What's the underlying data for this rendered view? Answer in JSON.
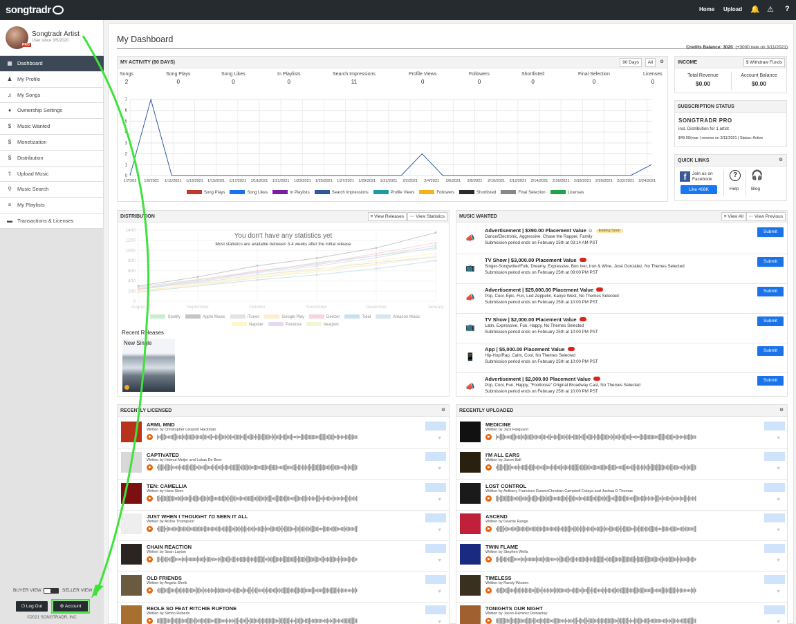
{
  "brand": {
    "logo": "songtradr"
  },
  "topnav": {
    "home": "Home",
    "upload": "Upload",
    "bell_icon": "bell-icon",
    "alert_icon": "warning-icon",
    "help": "?"
  },
  "profile": {
    "name": "Songtradr Artist",
    "since": "User since 3/5/2020",
    "badge": "PRO"
  },
  "sidebar": {
    "items": [
      {
        "label": "Dashboard",
        "icon": "dashboard-icon"
      },
      {
        "label": "My Profile",
        "icon": "user-icon"
      },
      {
        "label": "My Songs",
        "icon": "music-note-icon"
      },
      {
        "label": "Ownership Settings",
        "icon": "shield-icon"
      },
      {
        "label": "Music Wanted",
        "icon": "dollar-icon"
      },
      {
        "label": "Monetization",
        "icon": "dollar-icon"
      },
      {
        "label": "Distribution",
        "icon": "dollar-icon"
      },
      {
        "label": "Upload Music",
        "icon": "upload-icon"
      },
      {
        "label": "Music Search",
        "icon": "search-icon"
      },
      {
        "label": "My Playlists",
        "icon": "playlist-icon"
      },
      {
        "label": "Transactions & Licenses",
        "icon": "card-icon"
      }
    ],
    "buyer_view": "BUYER VIEW",
    "seller_view": "SELLER VIEW",
    "logout": "Log Out",
    "account": "Account",
    "copyright": "©2021 SONGTRADR, INC"
  },
  "page": {
    "title": "My Dashboard",
    "credits_label": "Credits Balance:",
    "credits_value": "3020",
    "credits_note": "(+3000 new on 3/11/2021)"
  },
  "activity": {
    "title": "MY ACTIVITY (90 DAYS)",
    "range_90": "90 Days",
    "range_all": "All",
    "stats": [
      {
        "label": "Songs",
        "value": "2"
      },
      {
        "label": "Song Plays",
        "value": "0"
      },
      {
        "label": "Song Likes",
        "value": "0"
      },
      {
        "label": "In Playlists",
        "value": "0"
      },
      {
        "label": "Search Impressions",
        "value": "11"
      },
      {
        "label": "Profile Views",
        "value": "0"
      },
      {
        "label": "Followers",
        "value": "0"
      },
      {
        "label": "Shortlisted",
        "value": "0"
      },
      {
        "label": "Final Selection",
        "value": "0"
      },
      {
        "label": "Licenses",
        "value": "0"
      }
    ]
  },
  "chart_data": [
    {
      "type": "line",
      "x": [
        "1/7/2021",
        "1/9/2021",
        "1/11/2021",
        "1/13/2021",
        "1/15/2021",
        "1/17/2021",
        "1/19/2021",
        "1/21/2021",
        "1/23/2021",
        "1/25/2021",
        "1/27/2021",
        "1/29/2021",
        "1/31/2021",
        "2/2/2021",
        "2/4/2021",
        "2/6/2021",
        "2/8/2021",
        "2/10/2021",
        "2/12/2021",
        "2/14/2021",
        "2/16/2021",
        "2/18/2021",
        "2/20/2021",
        "2/22/2021",
        "2/24/2021"
      ],
      "x_tick_labels": [
        "1/7/202",
        "1/9/2021",
        "1/11/2021",
        "1/13/2021",
        "1/15/2021",
        "1/17/2021",
        "1/19/2021",
        "1/21/2021",
        "1/23/2021",
        "1/25/2021",
        "1/27/2021",
        "1/29/2021",
        "1/31/2021",
        "2/2/2021",
        "2/4/2021",
        "2/6/2021",
        "2/8/2021",
        "2/10/2021",
        "2/12/2021",
        "2/14/2021",
        "2/16/2021",
        "2/18/2021",
        "2/20/2021",
        "2/22/2021",
        "2/24/2021"
      ],
      "y_ticks": [
        "0",
        "1",
        "2",
        "3",
        "4",
        "5",
        "6",
        "7"
      ],
      "ylim": [
        0,
        7
      ],
      "series": [
        {
          "name": "Song Plays",
          "color": "#c0392b",
          "values": []
        },
        {
          "name": "Song Likes",
          "color": "#1a73e8",
          "values": []
        },
        {
          "name": "In Playlists",
          "color": "#7b1fa2",
          "values": []
        },
        {
          "name": "Search Impressions",
          "color": "#2c5aa0",
          "values": [
            0,
            7,
            0,
            0,
            0,
            0,
            0,
            0,
            0,
            0,
            0,
            0,
            0,
            0,
            2,
            0,
            0,
            0,
            0,
            0,
            0,
            0,
            0,
            0,
            0,
            1
          ]
        },
        {
          "name": "Profile Views",
          "color": "#1e9aa8",
          "values": []
        },
        {
          "name": "Followers",
          "color": "#f5b21b",
          "values": []
        },
        {
          "name": "Shortlisted",
          "color": "#2b2b2b",
          "values": []
        },
        {
          "name": "Final Selection",
          "color": "#888888",
          "values": []
        },
        {
          "name": "Licenses",
          "color": "#22a34a",
          "values": []
        }
      ],
      "grid": true,
      "legend": "bottom"
    },
    {
      "type": "line",
      "categories": [
        "August",
        "September",
        "October",
        "November",
        "December",
        "January"
      ],
      "y_ticks": [
        "0",
        "200",
        "400",
        "600",
        "800",
        "1000",
        "1200",
        "1400"
      ],
      "ylim": [
        0,
        1400
      ],
      "series": [
        {
          "name": "Spotify",
          "color": "#a8e0b0",
          "values": [
            280,
            430,
            580,
            760,
            900,
            1040
          ]
        },
        {
          "name": "Apple Music",
          "color": "#a0a0a0",
          "values": [
            300,
            480,
            700,
            850,
            1050,
            1350
          ]
        },
        {
          "name": "iTunes",
          "color": "#d0d0d0",
          "values": [
            260,
            360,
            520,
            640,
            760,
            880
          ]
        },
        {
          "name": "Google Play",
          "color": "#fde3b0",
          "values": [
            200,
            330,
            470,
            610,
            730,
            870
          ]
        },
        {
          "name": "Deezer",
          "color": "#f5b9c8",
          "values": [
            250,
            420,
            600,
            740,
            940,
            1150
          ]
        },
        {
          "name": "Tidal",
          "color": "#a8cde8",
          "values": [
            180,
            300,
            420,
            520,
            640,
            800
          ]
        },
        {
          "name": "Amazon Music",
          "color": "#c0d4e8",
          "values": [
            230,
            380,
            560,
            690,
            860,
            1060
          ]
        },
        {
          "name": "Napster",
          "color": "#fff3a8",
          "values": [
            210,
            340,
            500,
            630,
            800,
            940
          ]
        },
        {
          "name": "Pandora",
          "color": "#d8c0e8",
          "values": [
            240,
            400,
            580,
            720,
            900,
            1100
          ]
        },
        {
          "name": "beatport",
          "color": "#e8f0b8",
          "values": [
            190,
            310,
            460,
            580,
            720,
            880
          ]
        }
      ],
      "legend": "bottom"
    }
  ],
  "income": {
    "title": "INCOME",
    "withdraw": "Withdraw Funds",
    "total_label": "Total Revenue",
    "total_value": "$0.00",
    "balance_label": "Account Balance",
    "balance_value": "$0.00"
  },
  "subscription": {
    "title": "SUBSCRIPTION STATUS",
    "plan": "SONGTRADR PRO",
    "desc": "incl. Distribution for 1 artist",
    "detail": "$49.00/year | renews on 3/11/2021 | Status: Active"
  },
  "quicklinks": {
    "title": "QUICK LINKS",
    "facebook1": "Join us on",
    "facebook2": "Facebook",
    "like": "Like 408K",
    "help": "Help",
    "blog": "Blog"
  },
  "distribution": {
    "title": "DISTRIBUTION",
    "view_releases": "View Releases",
    "view_statistics": "View Statistics",
    "empty_title": "You don't have any statistics yet",
    "empty_sub": "Most statistics are available between 3-4 weeks after the initial release",
    "recent_releases": "Recent Releases",
    "release_title": "New Single"
  },
  "music_wanted": {
    "title": "MUSIC WANTED",
    "view_all": "View All",
    "view_previous": "View Previous",
    "items": [
      {
        "title": "Advertisement | $390.00 Placement Value",
        "badge": "Ending Soon",
        "desc": "Dance/Electronic, Aggressive, Chase the Rapper, Family",
        "period": "Submission period ends on February 25th at 03:14 AM PST",
        "icon": "megaphone-icon",
        "submit": "Submit"
      },
      {
        "title": "TV Show | $3,000.00 Placement Value",
        "badge": "",
        "desc": "Singer-Songwriter/Folk, Dreamy, Expressive, Bon Iver, Iron & Wine, José González, No Themes Selected",
        "period": "Submission period ends on February 25th at 09:00 PM PST",
        "icon": "tv-icon",
        "submit": "Submit"
      },
      {
        "title": "Advertisement | $25,000.00 Placement Value",
        "badge": "",
        "desc": "Pop, Cool, Epic, Fun, Led Zeppelin, Kanye West, No Themes Selected",
        "period": "Submission period ends on February 25th at 10:00 PM PST",
        "icon": "megaphone-icon",
        "submit": "Submit"
      },
      {
        "title": "TV Show | $2,000.00 Placement Value",
        "badge": "",
        "desc": "Latin, Expressive, Fun, Happy, No Themes Selected",
        "period": "Submission period ends on February 25th at 10:00 PM PST",
        "icon": "tv-icon",
        "submit": "Submit"
      },
      {
        "title": "App | $5,000.00 Placement Value",
        "badge": "",
        "desc": "Hip-Hop/Rap, Calm, Cool, No Themes Selected",
        "period": "Submission period ends on February 25th at 10:00 PM PST",
        "icon": "phone-icon",
        "submit": "Submit"
      },
      {
        "title": "Advertisement | $2,000.00 Placement Value",
        "badge": "",
        "desc": "Pop, Cool, Fun, Happy, \"Footloose\" Original Broadway Cast, No Themes Selected",
        "period": "Submission period ends on February 25th at 10:00 PM PST",
        "icon": "megaphone-icon",
        "submit": "Submit"
      }
    ]
  },
  "recently_licensed": {
    "title": "RECENTLY LICENSED",
    "tracks": [
      {
        "title": "ARML MND",
        "by": "Written by Christopher Leopold Hackman",
        "color": "#b8321c"
      },
      {
        "title": "CAPTIVATED",
        "by": "Written by Helmut Meijer and Lukas De Beer",
        "color": "#d8d8d8"
      },
      {
        "title": "TEN: CAMELLIA",
        "by": "Written by Hans Shen",
        "color": "#7a1010"
      },
      {
        "title": "JUST WHEN I THOUGHT I'D SEEN IT ALL",
        "by": "Written by Archie Thompson",
        "color": "#eeeeee"
      },
      {
        "title": "CHAIN REACTION",
        "by": "Written by Sean Layton",
        "color": "#2a2520"
      },
      {
        "title": "OLD FRIENDS",
        "by": "Written by Angela Sheik",
        "color": "#6a5a40"
      },
      {
        "title": "REOLE SO FEAT RITCHIE RUFTONE",
        "by": "Written by Simon Roberts",
        "color": "#a87030"
      }
    ]
  },
  "recently_uploaded": {
    "title": "RECENTLY UPLOADED",
    "tracks": [
      {
        "title": "MEDICINE",
        "by": "Written by Jack Farguson",
        "color": "#111111"
      },
      {
        "title": "I'M ALL EARS",
        "by": "Written by Jason Ball",
        "color": "#2a2010"
      },
      {
        "title": "LOST CONTROL",
        "by": "Written by Anthony Francisco RanereChristian Campbell Celaya and Joshua D Thomas",
        "color": "#1a1a1a"
      },
      {
        "title": "ASCEND",
        "by": "Written by Deante Range",
        "color": "#c0203a"
      },
      {
        "title": "TWIN FLAME",
        "by": "Written by Stephen Wells",
        "color": "#1a2a80"
      },
      {
        "title": "TIMELESS",
        "by": "Written by Randy Wooten",
        "color": "#3a3020"
      },
      {
        "title": "TONIGHTS OUR NIGHT",
        "by": "Written by Jason Ramirez Domantay",
        "color": "#a06030"
      }
    ]
  }
}
